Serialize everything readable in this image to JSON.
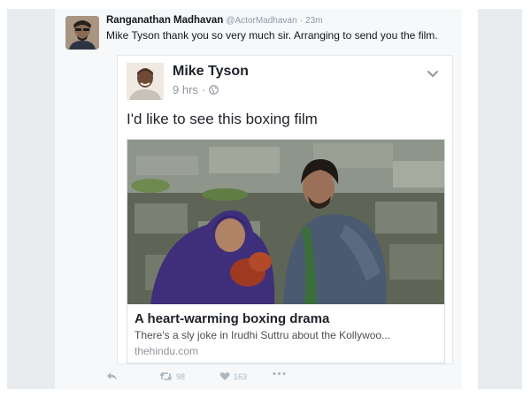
{
  "tweet": {
    "author_name": "Ranganathan Madhavan",
    "author_handle": "@ActorMadhavan",
    "separator": "·",
    "time": "23m",
    "text": "Mike Tyson thank you so very much sir. Arranging to send you the film.",
    "avatar_icon": "user-photo",
    "actions": {
      "reply_icon": "reply-icon",
      "retweet_count": "98",
      "like_count": "163",
      "more_icon": "more-icon"
    }
  },
  "embedded_post": {
    "author_name": "Mike Tyson",
    "time": "9 hrs",
    "separator": "·",
    "audience_icon": "globe-icon",
    "menu_icon": "chevron-down-icon",
    "text": "I'd like to see this boxing film",
    "link": {
      "title": "A heart-warming boxing drama",
      "description": "There's a sly joke in Irudhi Suttru about the Kollywoo...",
      "domain": "thehindu.com"
    }
  },
  "colors": {
    "page_bg": "#ffffff",
    "side_columns": "#e9ecef",
    "tweet_panel": "#f7f8fa",
    "icon_gray": "#aab8c2"
  }
}
